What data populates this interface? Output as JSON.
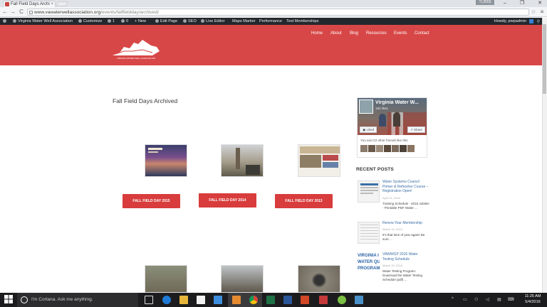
{
  "browser": {
    "tab_title": "Fall Field Days Archi",
    "tab_close": "×",
    "user_badge": "TL3555",
    "url_domain": "www.vawaterwellassociation.org",
    "url_path": "/events/fallfieldday/archived/",
    "back": "←",
    "forward": "→",
    "reload": "C",
    "star": "☆",
    "menu": "≡",
    "win_min": "–",
    "win_max": "❐",
    "win_close": "✕"
  },
  "adminbar": {
    "site_name": "Virginia Water Well Association",
    "customize": "Customize",
    "updates": "1",
    "comments": "0",
    "new": "+ New",
    "edit_page": "Edit Page",
    "seo": "SEO",
    "live_editor": "Live Editor",
    "maps_marker": "Maps Marker",
    "performance": "Performance",
    "test_memberships": "Test Memberships",
    "howdy": "Howdy, pwpadmin"
  },
  "site": {
    "nav": [
      "Home",
      "About",
      "Blog",
      "Resources",
      "Events",
      "Contact"
    ],
    "logo_text": "VIRGINIA WATER WELL ASSOCIATION",
    "page_title": "Fall Field Days Archived",
    "archive_buttons": [
      "FALL FIELD DAY 2015",
      "FALL FIELD DAY 2014",
      "FALL FIELD DAY 2013"
    ]
  },
  "sidebar": {
    "fb": {
      "name": "Virginia Water W...",
      "likes": "193 likes",
      "liked_label": "Liked",
      "share_label": "Share",
      "friends_text": "You and 23 other friends like this"
    },
    "recent_posts_title": "RECENT POSTS",
    "posts": [
      {
        "title": "Water Systems Council Primer & Refresher Course – Registration Open!",
        "date": "April 21, 2016",
        "excerpt": "Training Schedule - 2016 Jubilee - Printable PDF Water ..."
      },
      {
        "title": "Renew Your Membership",
        "date": "March 15, 2016",
        "excerpt": "It's that time of year again! Be sure ..."
      },
      {
        "title": "VAWWGP 2016 Water Testing Schedule",
        "date": "March 15, 2016",
        "excerpt": "Water Testing Program: Download the Water Testing Schedule (pdf) ..."
      }
    ],
    "post3_thumb_text": [
      "VIRGINIA I",
      "WATER QU",
      "PROGRAM"
    ]
  },
  "taskbar": {
    "cortana_placeholder": "I'm Cortana. Ask me anything.",
    "time": "11:25 AM",
    "date": "5/4/2016"
  },
  "colors": {
    "header_red": "#d84747",
    "button_red": "#d83c3c",
    "admin_bar": "#23282d",
    "link_blue": "#3a6ea5"
  }
}
